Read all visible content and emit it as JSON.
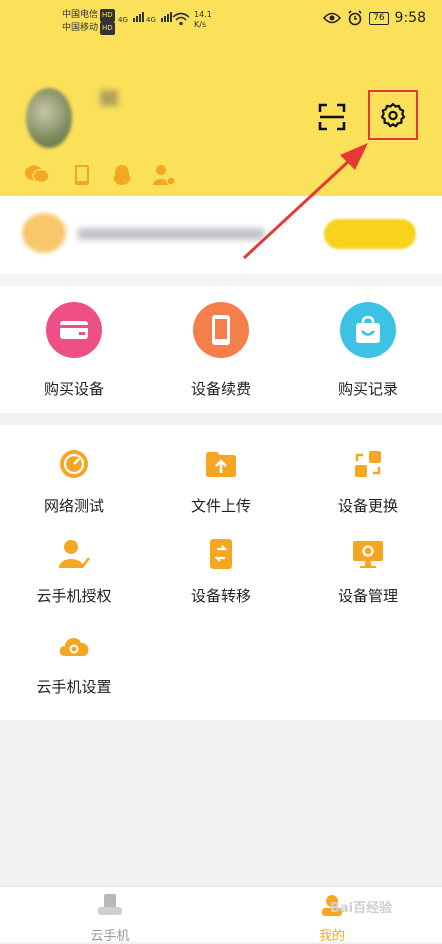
{
  "status_bar": {
    "carrier1": "中国电信",
    "carrier2": "中国移动",
    "hd": "HD",
    "net": "4G",
    "speed_value": "14.1",
    "speed_unit": "K/s",
    "battery": "76",
    "time": "9:58"
  },
  "settings_highlight_color": "#e53935",
  "menu1": [
    {
      "label": "购买设备",
      "icon": "card-icon",
      "color": "#ee4f86"
    },
    {
      "label": "设备续费",
      "icon": "phone-icon",
      "color": "#f57f4b"
    },
    {
      "label": "购买记录",
      "icon": "bag-icon",
      "color": "#3dc2e6"
    }
  ],
  "menu2": [
    {
      "label": "网络测试",
      "icon": "speedometer-icon"
    },
    {
      "label": "文件上传",
      "icon": "folder-upload-icon"
    },
    {
      "label": "设备更换",
      "icon": "swap-icon"
    },
    {
      "label": "云手机授权",
      "icon": "user-check-icon"
    },
    {
      "label": "设备转移",
      "icon": "phone-transfer-icon"
    },
    {
      "label": "设备管理",
      "icon": "monitor-gear-icon"
    },
    {
      "label": "云手机设置",
      "icon": "cloud-settings-icon"
    }
  ],
  "tabs": [
    {
      "label": "云手机",
      "icon": "cloud-phone-tab-icon"
    },
    {
      "label": "我的",
      "icon": "me-tab-icon"
    }
  ],
  "watermark": "Bai百经验"
}
